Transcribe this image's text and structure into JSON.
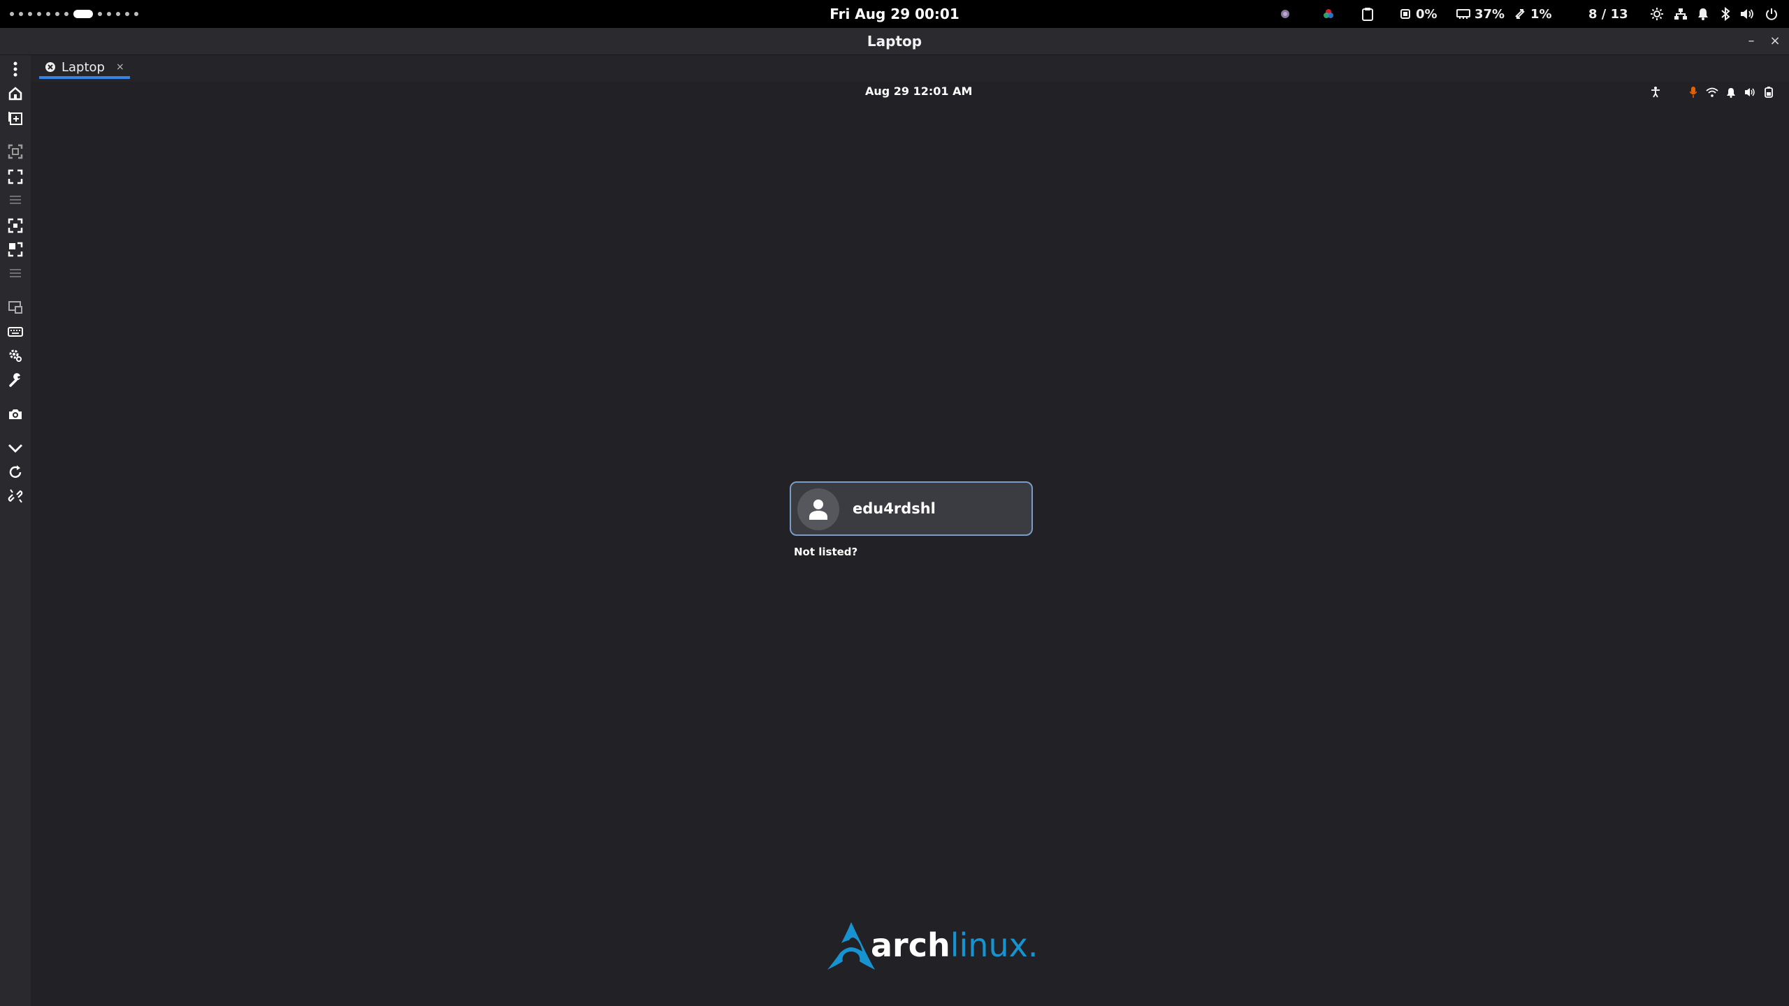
{
  "topbar": {
    "workspaces_total": 13,
    "workspace_active_index": 7,
    "clock": "Fri Aug 29  00:01",
    "cpu": "0%",
    "memory": "37%",
    "swap": "1%",
    "workspace_counter": "8 / 13"
  },
  "window": {
    "title": "Laptop",
    "minimize": "–",
    "close": "×"
  },
  "tabs": [
    {
      "label": "Laptop",
      "close": "×"
    }
  ],
  "greeter": {
    "datetime": "Aug 29  12:01 AM",
    "username": "edu4rdshl",
    "not_listed": "Not listed?",
    "logo_arch": "arch",
    "logo_linux": "linux"
  },
  "colors": {
    "accent": "#3584e4",
    "arch_blue": "#1793d1",
    "mic_active": "#e66100"
  }
}
